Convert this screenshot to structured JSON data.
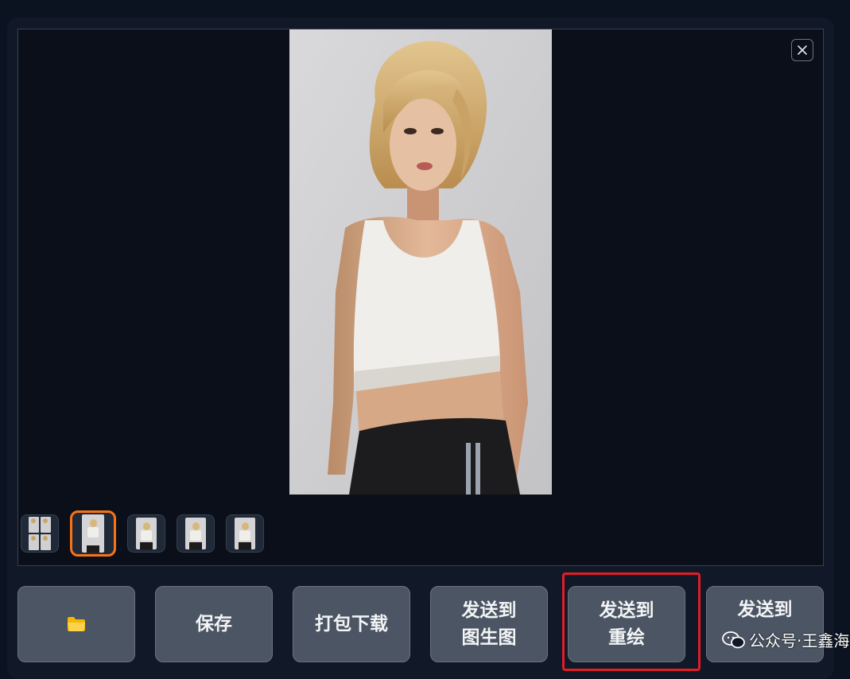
{
  "gallery": {
    "close_icon": "close-icon",
    "thumbnails": [
      {
        "kind": "grid",
        "selected": false
      },
      {
        "kind": "single",
        "selected": true
      },
      {
        "kind": "single",
        "selected": false
      },
      {
        "kind": "single",
        "selected": false
      },
      {
        "kind": "single",
        "selected": false
      }
    ]
  },
  "actions": {
    "folder_icon": "folder-icon",
    "save_label": "保存",
    "zip_download_label": "打包下载",
    "send_img2img_label": "发送到\n图生图",
    "send_inpaint_label": "发送到\n重绘",
    "send_extras_label": "发送到"
  },
  "watermark": {
    "text": "公众号·王鑫海",
    "icon": "wechat-icon"
  },
  "colors": {
    "selected_border": "#f97316",
    "highlight_box": "#e11d28",
    "button_bg": "#4b5563"
  }
}
